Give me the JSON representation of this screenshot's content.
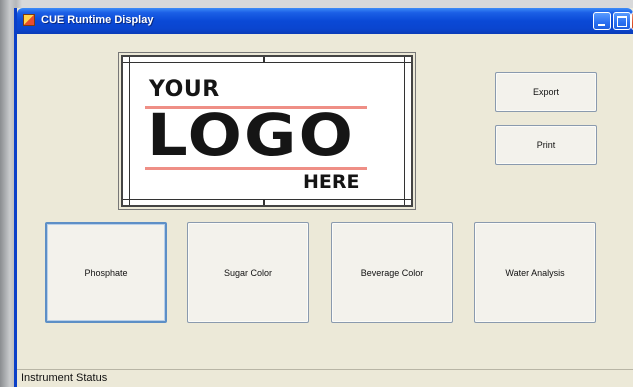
{
  "window": {
    "title": "CUE Runtime Display"
  },
  "logo": {
    "top": "YOUR",
    "main": "LOGO",
    "bottom": "HERE"
  },
  "actions": {
    "export_label": "Export",
    "print_label": "Print"
  },
  "instruments": [
    {
      "label": "Phosphate"
    },
    {
      "label": "Sugar Color"
    },
    {
      "label": "Beverage Color"
    },
    {
      "label": "Water Analysis"
    }
  ],
  "status": {
    "text": "Instrument Status"
  },
  "colors": {
    "titlebar": "#0a49d6",
    "window_bg": "#ece9d8",
    "logo_accent": "#ef8f86",
    "focus_border": "#5d8fc6"
  }
}
